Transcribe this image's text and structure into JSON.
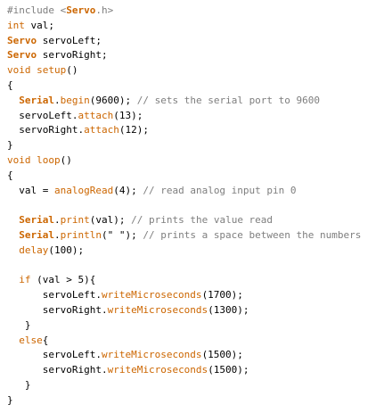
{
  "code": {
    "lines": [
      [
        {
          "t": "#include <",
          "c": "pp"
        },
        {
          "t": "Servo",
          "c": "obj"
        },
        {
          "t": ".h>",
          "c": "pp"
        }
      ],
      [
        {
          "t": "int",
          "c": "type"
        },
        {
          "t": " val;",
          "c": "id"
        }
      ],
      [
        {
          "t": "Servo",
          "c": "obj"
        },
        {
          "t": " servoLeft;",
          "c": "id"
        }
      ],
      [
        {
          "t": "Servo",
          "c": "obj"
        },
        {
          "t": " servoRight;",
          "c": "id"
        }
      ],
      [
        {
          "t": "void",
          "c": "type"
        },
        {
          "t": " ",
          "c": "id"
        },
        {
          "t": "setup",
          "c": "func"
        },
        {
          "t": "()",
          "c": "id"
        }
      ],
      [
        {
          "t": "{",
          "c": "id"
        }
      ],
      [
        {
          "t": "  ",
          "c": "id"
        },
        {
          "t": "Serial",
          "c": "obj"
        },
        {
          "t": ".",
          "c": "id"
        },
        {
          "t": "begin",
          "c": "func"
        },
        {
          "t": "(9600); ",
          "c": "id"
        },
        {
          "t": "// sets the serial port to 9600",
          "c": "com"
        }
      ],
      [
        {
          "t": "  servoLeft.",
          "c": "id"
        },
        {
          "t": "attach",
          "c": "func"
        },
        {
          "t": "(13);",
          "c": "id"
        }
      ],
      [
        {
          "t": "  servoRight.",
          "c": "id"
        },
        {
          "t": "attach",
          "c": "func"
        },
        {
          "t": "(12);",
          "c": "id"
        }
      ],
      [
        {
          "t": "}",
          "c": "id"
        }
      ],
      [
        {
          "t": "void",
          "c": "type"
        },
        {
          "t": " ",
          "c": "id"
        },
        {
          "t": "loop",
          "c": "func"
        },
        {
          "t": "()",
          "c": "id"
        }
      ],
      [
        {
          "t": "{",
          "c": "id"
        }
      ],
      [
        {
          "t": "  val = ",
          "c": "id"
        },
        {
          "t": "analogRead",
          "c": "func"
        },
        {
          "t": "(4); ",
          "c": "id"
        },
        {
          "t": "// read analog input pin 0",
          "c": "com"
        }
      ],
      [],
      [
        {
          "t": "  ",
          "c": "id"
        },
        {
          "t": "Serial",
          "c": "obj"
        },
        {
          "t": ".",
          "c": "id"
        },
        {
          "t": "print",
          "c": "func"
        },
        {
          "t": "(val); ",
          "c": "id"
        },
        {
          "t": "// prints the value read",
          "c": "com"
        }
      ],
      [
        {
          "t": "  ",
          "c": "id"
        },
        {
          "t": "Serial",
          "c": "obj"
        },
        {
          "t": ".",
          "c": "id"
        },
        {
          "t": "println",
          "c": "func"
        },
        {
          "t": "(\" \"); ",
          "c": "id"
        },
        {
          "t": "// prints a space between the numbers",
          "c": "com"
        }
      ],
      [
        {
          "t": "  ",
          "c": "id"
        },
        {
          "t": "delay",
          "c": "func"
        },
        {
          "t": "(100);",
          "c": "id"
        }
      ],
      [],
      [
        {
          "t": "  ",
          "c": "id"
        },
        {
          "t": "if",
          "c": "kw"
        },
        {
          "t": " (val > 5){",
          "c": "id"
        }
      ],
      [
        {
          "t": "      servoLeft.",
          "c": "id"
        },
        {
          "t": "writeMicroseconds",
          "c": "func"
        },
        {
          "t": "(1700);",
          "c": "id"
        }
      ],
      [
        {
          "t": "      servoRight.",
          "c": "id"
        },
        {
          "t": "writeMicroseconds",
          "c": "func"
        },
        {
          "t": "(1300);",
          "c": "id"
        }
      ],
      [
        {
          "t": "   }",
          "c": "id"
        }
      ],
      [
        {
          "t": "  ",
          "c": "id"
        },
        {
          "t": "else",
          "c": "kw"
        },
        {
          "t": "{",
          "c": "id"
        }
      ],
      [
        {
          "t": "      servoLeft.",
          "c": "id"
        },
        {
          "t": "writeMicroseconds",
          "c": "func"
        },
        {
          "t": "(1500);",
          "c": "id"
        }
      ],
      [
        {
          "t": "      servoRight.",
          "c": "id"
        },
        {
          "t": "writeMicroseconds",
          "c": "func"
        },
        {
          "t": "(1500);",
          "c": "id"
        }
      ],
      [
        {
          "t": "   }",
          "c": "id"
        }
      ],
      [
        {
          "t": "}",
          "c": "id"
        }
      ]
    ]
  }
}
